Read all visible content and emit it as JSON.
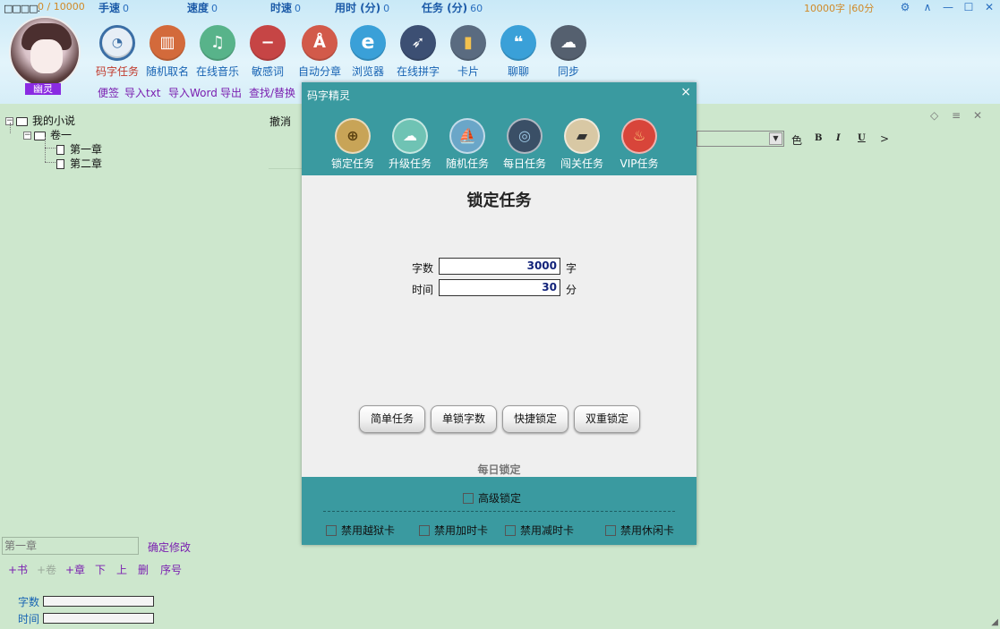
{
  "header": {
    "squares": "□□□□.",
    "word_count": "0 / 10000",
    "stats": [
      {
        "label": "手速",
        "value": "0"
      },
      {
        "label": "速度",
        "value": "0"
      },
      {
        "label": "时速",
        "value": "0"
      },
      {
        "label": "用时 (分)",
        "value": "0"
      },
      {
        "label": "任务 (分)",
        "value": "60"
      }
    ],
    "task_status": "10000字 |60分",
    "avatar_name": "幽灵"
  },
  "toolbar": [
    {
      "label": "码字任务",
      "icon": "speedometer-icon",
      "color": "#3b6ea5",
      "active": true
    },
    {
      "label": "随机取名",
      "icon": "contacts-book-icon",
      "color": "#d36a3b"
    },
    {
      "label": "在线音乐",
      "icon": "music-note-icon",
      "color": "#58b38a"
    },
    {
      "label": "敏感词",
      "icon": "block-icon",
      "color": "#c64545"
    },
    {
      "label": "自动分章",
      "icon": "compass-icon",
      "color": "#d25a4a"
    },
    {
      "label": "浏览器",
      "icon": "browser-e-icon",
      "color": "#3aa0d8"
    },
    {
      "label": "在线拼字",
      "icon": "rocket-icon",
      "color": "#3c4f73"
    },
    {
      "label": "卡片",
      "icon": "bookmark-icon",
      "color": "#d9a441"
    },
    {
      "label": "聊聊",
      "icon": "chat-bubble-icon",
      "color": "#3aa0d8"
    },
    {
      "label": "同步",
      "icon": "cloud-sun-icon",
      "color": "#55606f"
    }
  ],
  "menu": [
    "便签",
    "导入txt",
    "导入Word",
    "导出",
    "查找/替换"
  ],
  "tree": {
    "root": "我的小说",
    "volume": "卷一",
    "chapters": [
      "第一章",
      "第二章"
    ]
  },
  "left_panel": {
    "chapter_placeholder": "第一章",
    "confirm_label": "确定修改",
    "actions": [
      {
        "label": "+书",
        "dim": false
      },
      {
        "label": "+卷",
        "dim": true
      },
      {
        "label": "+章",
        "dim": false
      },
      {
        "label": "下",
        "dim": false
      },
      {
        "label": "上",
        "dim": false
      },
      {
        "label": "删",
        "dim": false
      },
      {
        "label": "序号",
        "dim": false
      }
    ],
    "word_count_label": "字数",
    "time_label": "时间"
  },
  "editor": {
    "undo_label": "撤消",
    "color_label": "色",
    "bold": "B",
    "italic": "I",
    "underline": "U",
    "more": ">"
  },
  "dialog": {
    "title": "码字精灵",
    "close": "×",
    "tabs": [
      {
        "label": "锁定任务",
        "icon": "crosshair-icon",
        "color": "#c8a457"
      },
      {
        "label": "升级任务",
        "icon": "cloud-upload-icon",
        "color": "#6fc3b4"
      },
      {
        "label": "随机任务",
        "icon": "sailboat-icon",
        "color": "#6aa6c8"
      },
      {
        "label": "每日任务",
        "icon": "disc-icon",
        "color": "#3a4f66"
      },
      {
        "label": "闯关任务",
        "icon": "barrier-icon",
        "color": "#d8c8a4"
      },
      {
        "label": "VIP任务",
        "icon": "flame-icon",
        "color": "#d8453a"
      }
    ],
    "heading": "锁定任务",
    "fields": [
      {
        "label": "字数",
        "value": "3000",
        "unit": "字"
      },
      {
        "label": "时间",
        "value": "30",
        "unit": "分"
      }
    ],
    "buttons": [
      "简单任务",
      "单锁字数",
      "快捷锁定",
      "双重锁定"
    ],
    "daily_lock": "每日锁定",
    "advanced_lock": "高级锁定",
    "options": [
      "禁用越狱卡",
      "禁用加时卡",
      "禁用减时卡",
      "禁用休闲卡"
    ]
  }
}
